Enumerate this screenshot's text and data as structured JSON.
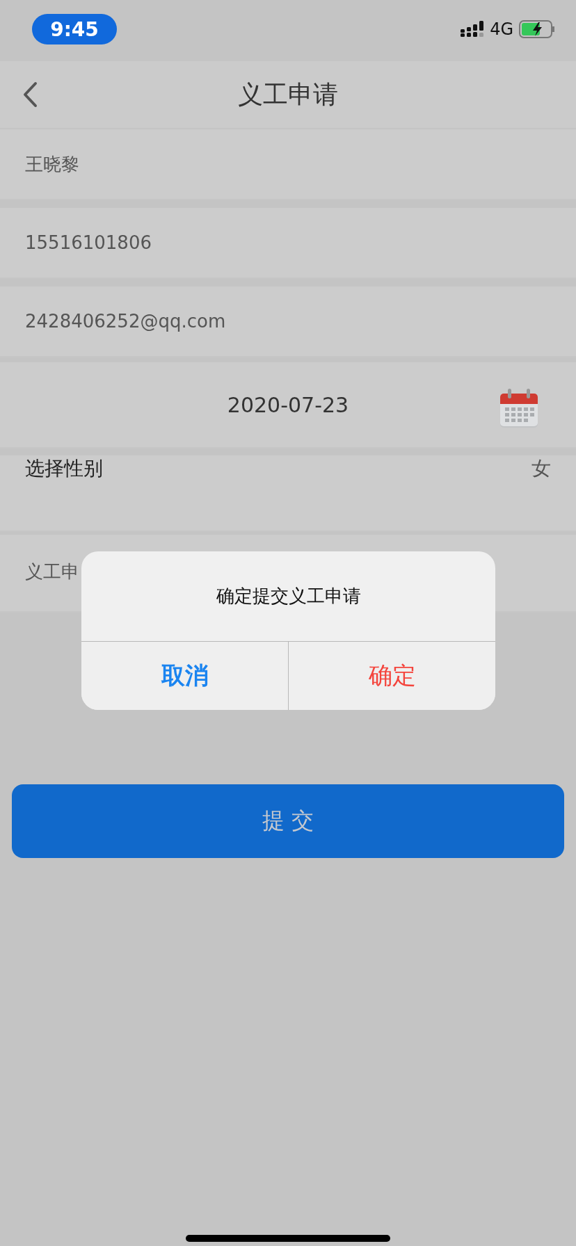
{
  "status_bar": {
    "time": "9:45",
    "network": "4G"
  },
  "nav": {
    "title": "义工申请"
  },
  "form": {
    "fields": [
      {
        "value": "王晓黎"
      },
      {
        "value": "15516101806"
      },
      {
        "value": "2428406252@qq.com"
      }
    ],
    "date": {
      "value": "2020-07-23"
    },
    "gender": {
      "label": "选择性别",
      "value": "女"
    },
    "note": {
      "value": "义工申"
    }
  },
  "submit": {
    "label": "提 交"
  },
  "dialog": {
    "message": "确定提交义工申请",
    "buttons": [
      {
        "kind": "cancel",
        "label": "取消"
      },
      {
        "kind": "confirm",
        "label": "确定"
      }
    ]
  }
}
